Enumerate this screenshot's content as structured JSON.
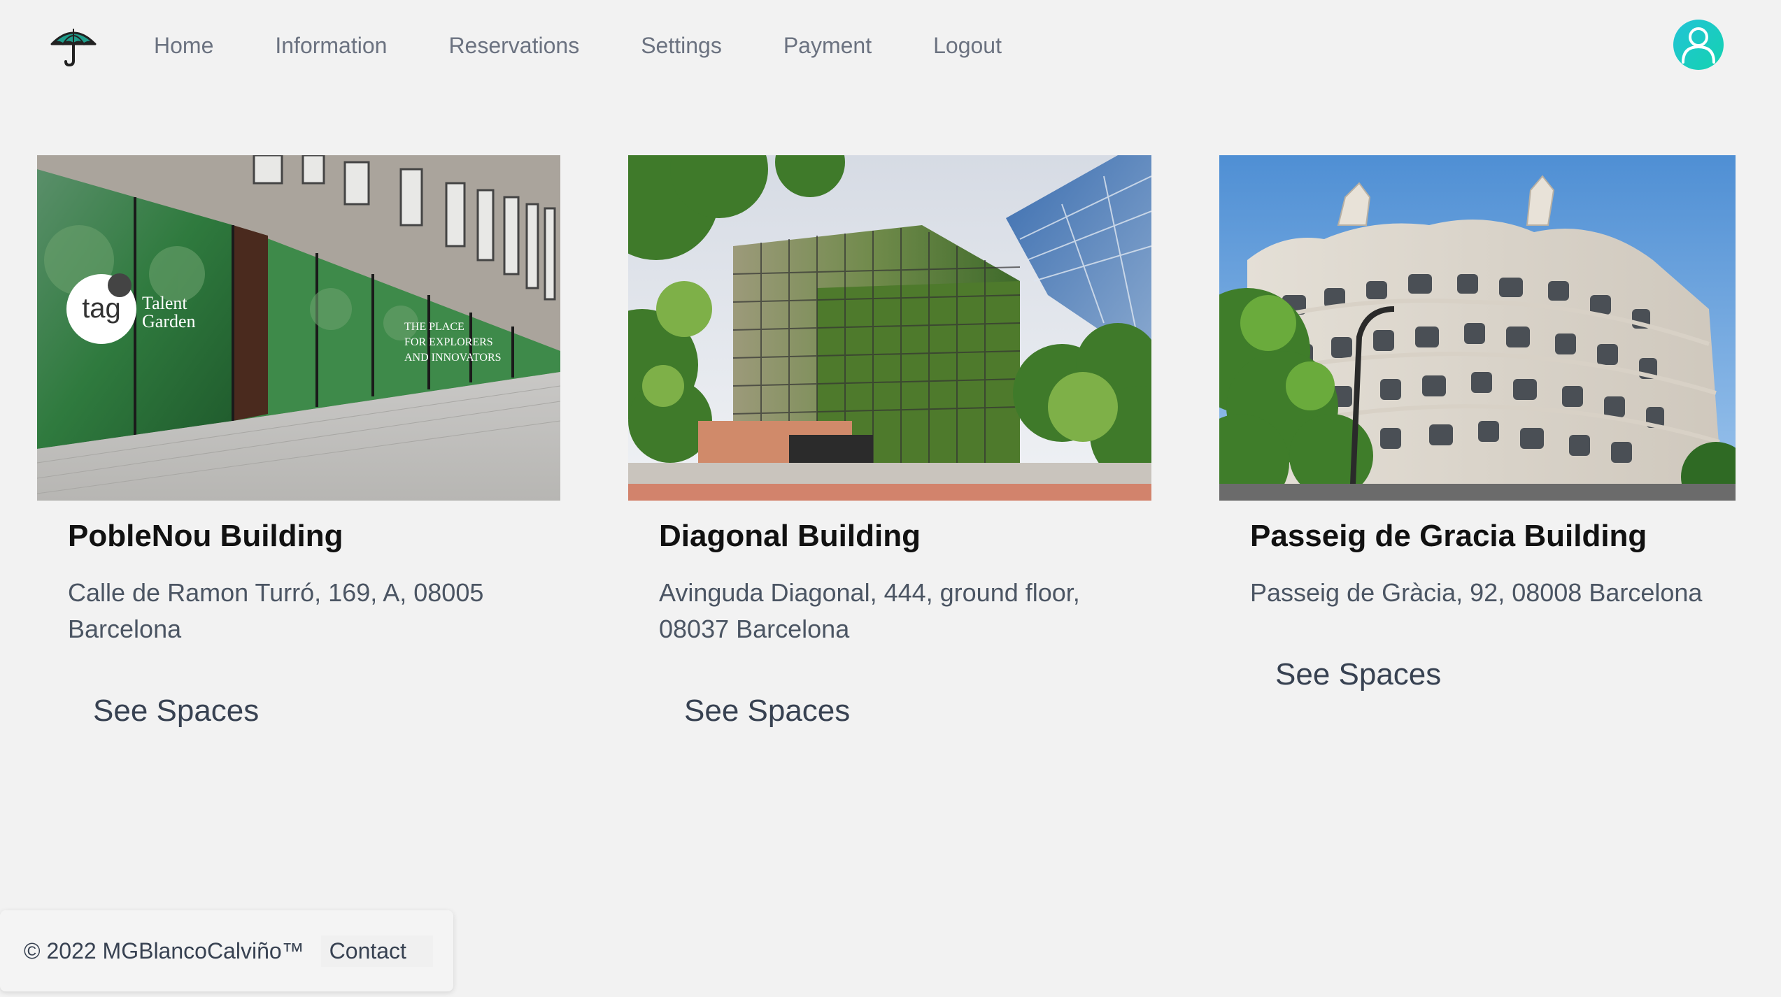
{
  "nav": {
    "logo": "umbrella-icon",
    "links": [
      "Home",
      "Information",
      "Reservations",
      "Settings",
      "Payment",
      "Logout"
    ],
    "avatar_icon": "user-icon",
    "avatar_color": "#1ec9c4"
  },
  "buildings": [
    {
      "name": "PobleNou Building",
      "address": "Calle de Ramon Turró, 169, A, 08005 Barcelona",
      "button": "See Spaces",
      "image_text": [
        "tag",
        "Talent",
        "Garden",
        "THE PLACE",
        "FOR EXPLORERS",
        "AND INNOVATORS"
      ]
    },
    {
      "name": "Diagonal Building",
      "address": "Avinguda Diagonal, 444, ground floor, 08037 Barcelona",
      "button": "See Spaces"
    },
    {
      "name": "Passeig de Gracia Building",
      "address": "Passeig de Gràcia, 92, 08008 Barcelona",
      "button": "See Spaces"
    }
  ],
  "footer": {
    "copyright": "© 2022 MGBlancoCalviño™",
    "contact": "Contact"
  }
}
